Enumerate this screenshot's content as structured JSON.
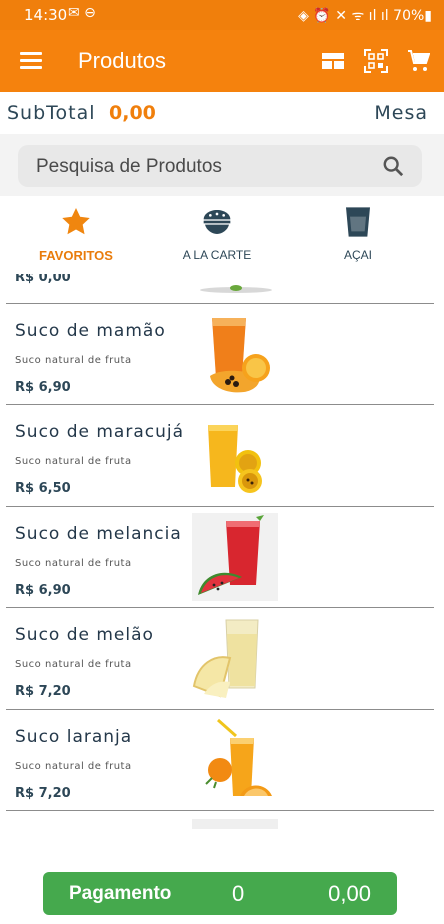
{
  "status_bar": {
    "time": "14:30",
    "battery": "70%"
  },
  "app_bar": {
    "title": "Produtos"
  },
  "summary": {
    "subtotal_label": "SubTotal",
    "subtotal_value": "0,00",
    "mesa_label": "Mesa"
  },
  "search": {
    "placeholder": "Pesquisa de Produtos"
  },
  "tabs": [
    {
      "label": "FAVORITOS",
      "icon": "star-icon",
      "active": true
    },
    {
      "label": "A LA CARTE",
      "icon": "food-bowl-icon",
      "active": false
    },
    {
      "label": "AÇAI",
      "icon": "cup-icon",
      "active": false
    }
  ],
  "colors": {
    "primary": "#f5820d",
    "accent_text": "#f07f0c",
    "dark_text": "#2d4757",
    "pay_button": "#45a94d"
  },
  "products_partial_top": {
    "price": "R$ 0,00"
  },
  "products": [
    {
      "name": "Suco de mamão",
      "description": "Suco natural de fruta",
      "price": "R$ 6,90",
      "image": "papaya-juice"
    },
    {
      "name": "Suco de maracujá",
      "description": "Suco natural de fruta",
      "price": "R$ 6,50",
      "image": "passion-fruit-juice"
    },
    {
      "name": "Suco de melancia",
      "description": "Suco natural de fruta",
      "price": "R$ 6,90",
      "image": "watermelon-juice"
    },
    {
      "name": "Suco de melão",
      "description": "Suco natural de fruta",
      "price": "R$ 7,20",
      "image": "melon-juice"
    },
    {
      "name": "Suco laranja",
      "description": "Suco natural de fruta",
      "price": "R$ 7,20",
      "image": "orange-juice"
    }
  ],
  "payment": {
    "label": "Pagamento",
    "count": "0",
    "total": "0,00"
  }
}
